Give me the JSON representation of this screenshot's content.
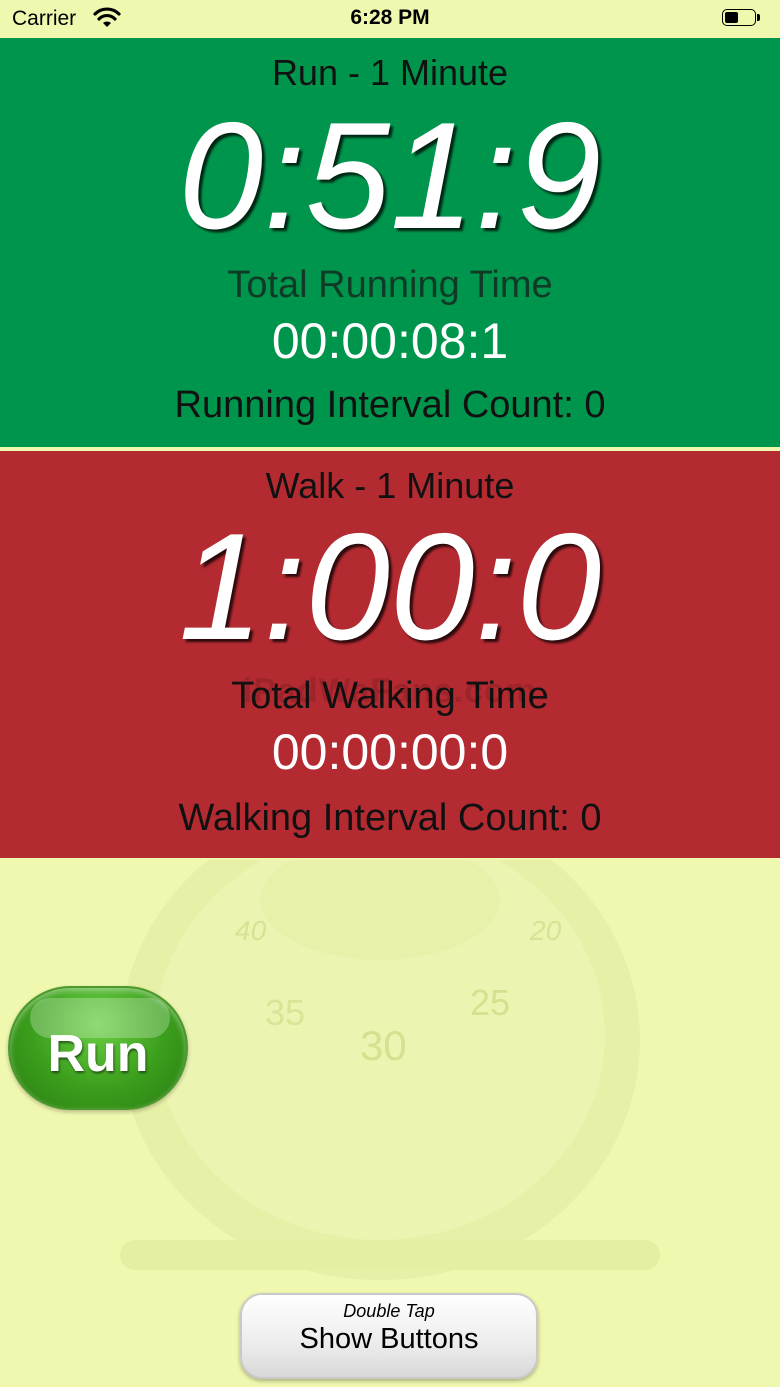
{
  "status_bar": {
    "carrier": "Carrier",
    "time": "6:28 PM",
    "wifi_icon": "wifi-icon",
    "battery_icon": "battery-icon"
  },
  "run_panel": {
    "title": "Run - 1 Minute",
    "countdown": "0:51:9",
    "total_label": "Total Running Time",
    "total_time": "00:00:08:1",
    "interval_count": "Running Interval Count: 0",
    "color": "#00954c"
  },
  "walk_panel": {
    "title": "Walk - 1 Minute",
    "countdown": "1:00:0",
    "total_label": "Total Walking Time",
    "total_time": "00:00:00:0",
    "interval_count": "Walking Interval Count: 0",
    "color": "#b32a31"
  },
  "watermark": "iPadWaFans.com",
  "background_dial": {
    "labels": [
      "40",
      "20",
      "35",
      "25",
      "30"
    ]
  },
  "run_button": {
    "label": "Run"
  },
  "show_buttons": {
    "hint": "Double Tap",
    "label": "Show Buttons"
  }
}
